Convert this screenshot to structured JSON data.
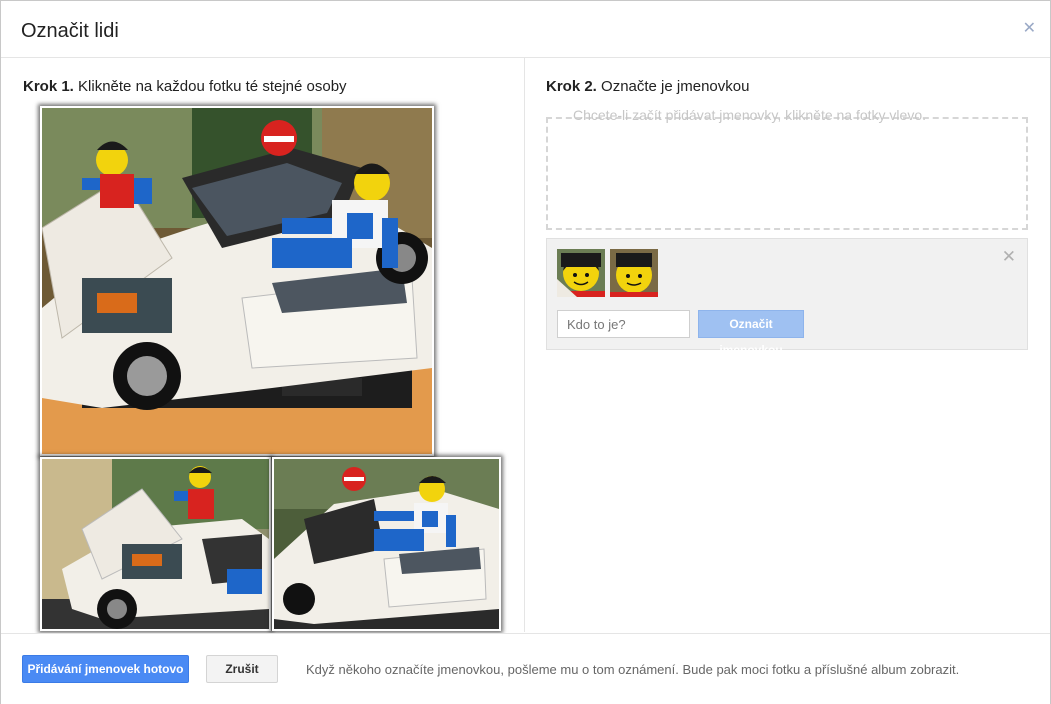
{
  "dialog": {
    "title": "Označit lidi",
    "close_icon": "close-icon"
  },
  "step1": {
    "label": "Krok 1.",
    "text": "Klikněte na každou fotku té stejné osoby"
  },
  "step2": {
    "label": "Krok 2.",
    "text": "Označte je jmenovkou",
    "drop_hint": "Chcete-li začít přidávat jmenovky, klikněte na fotky vlevo."
  },
  "tag_panel": {
    "close_icon": "close-icon",
    "input_placeholder": "Kdo to je?",
    "tag_button": "Označit jmenovkou"
  },
  "footer": {
    "done_button": "Přidávání jmenovek hotovo",
    "cancel_button": "Zrušit",
    "note": "Když někoho označíte jmenovkou, pošleme mu o tom oznámení. Bude pak moci fotku a příslušné album zobrazit."
  },
  "colors": {
    "primary_blue": "#4a8af4",
    "disabled_blue": "#9fc1f2",
    "lego_yellow": "#f2d30d",
    "lego_red": "#d8231f",
    "lego_blue": "#1e66c9"
  }
}
